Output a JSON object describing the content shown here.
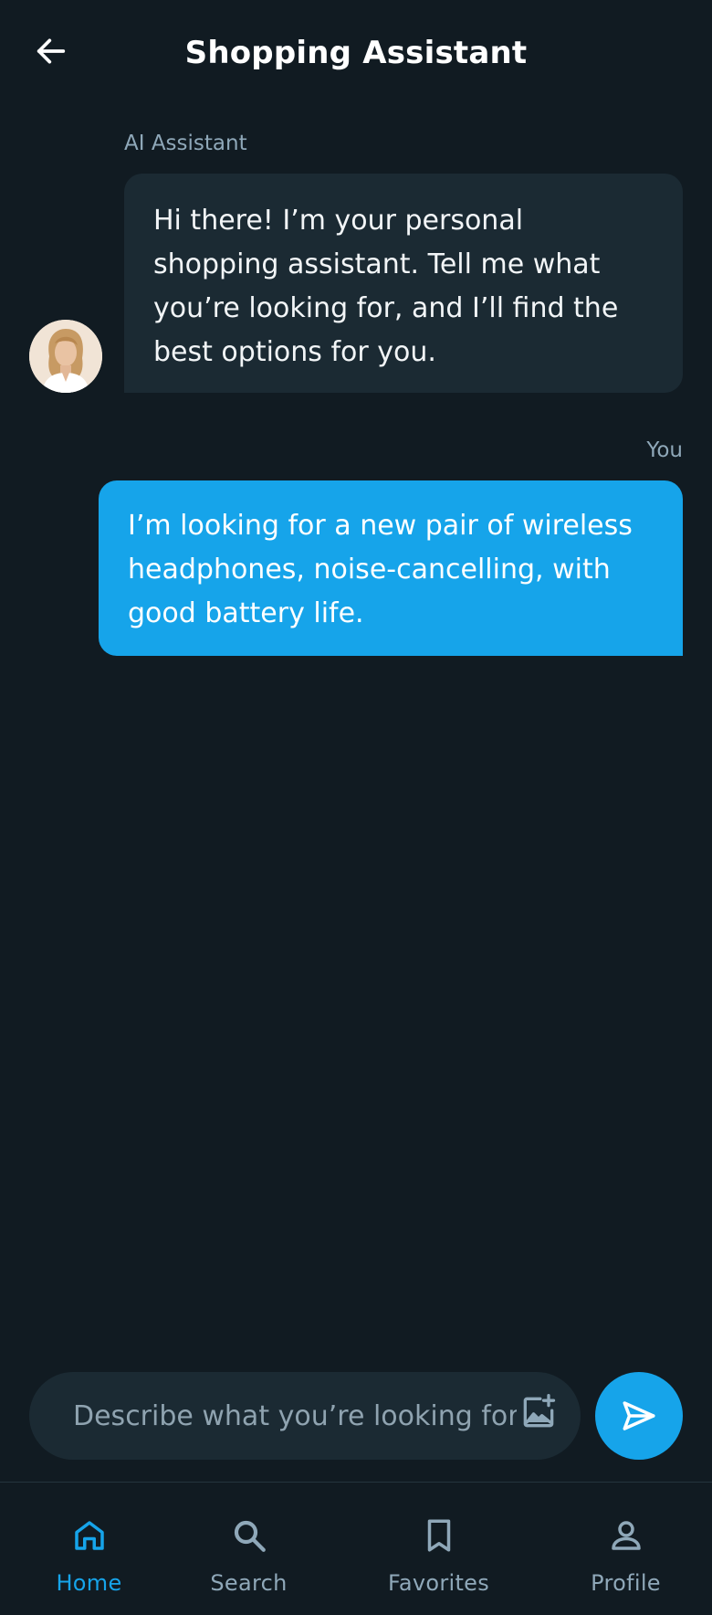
{
  "header": {
    "title": "Shopping Assistant",
    "back_icon": "arrow-left-icon"
  },
  "messages": [
    {
      "sender_label": "AI Assistant",
      "text": "Hi there! I’m your personal shopping assistant. Tell me what you’re looking for, and I’ll find the best options for you."
    },
    {
      "sender_label": "You",
      "text": "I’m looking for a new pair of wireless headphones, noise-cancelling, with good battery life."
    }
  ],
  "composer": {
    "placeholder": "Describe what you’re looking for...",
    "value": "",
    "attach_icon": "add-photo-icon",
    "send_icon": "send-icon"
  },
  "nav": {
    "items": [
      {
        "label": "Home",
        "icon": "home-icon",
        "active": true
      },
      {
        "label": "Search",
        "icon": "search-icon",
        "active": false
      },
      {
        "label": "Favorites",
        "icon": "bookmark-icon",
        "active": false
      },
      {
        "label": "Profile",
        "icon": "person-icon",
        "active": false
      }
    ]
  },
  "colors": {
    "background": "#111b22",
    "ai_bubble": "#1b2a33",
    "user_bubble": "#16a4ea",
    "accent": "#16a4ea",
    "muted_text": "#8fa8b9"
  }
}
